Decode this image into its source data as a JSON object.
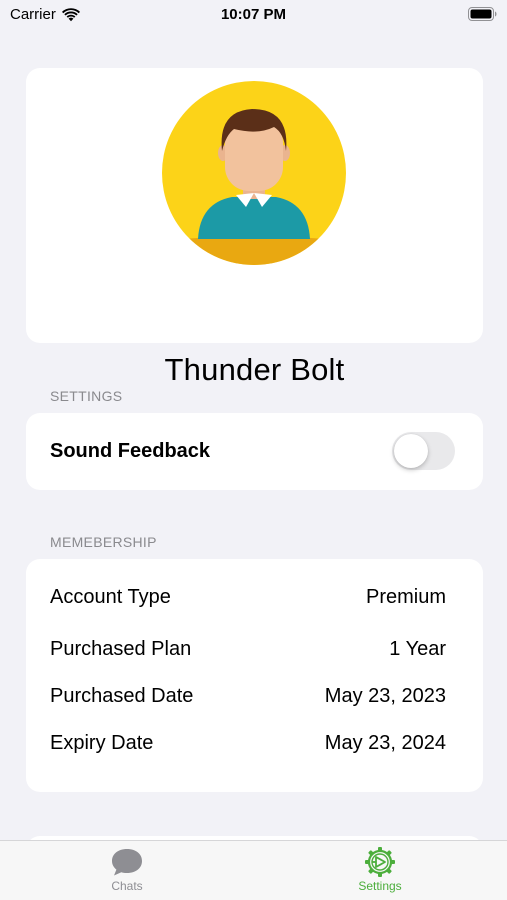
{
  "status_bar": {
    "carrier": "Carrier",
    "time": "10:07 PM"
  },
  "profile": {
    "name": "Thunder Bolt",
    "avatar_icon": "person-avatar-icon",
    "avatar_bg_color": "#fcd318"
  },
  "settings_section": {
    "header": "SETTINGS",
    "sound_feedback_label": "Sound Feedback",
    "sound_feedback_enabled": false
  },
  "membership_section": {
    "header": "MEMEBERSHIP",
    "rows": [
      {
        "label": "Account Type",
        "value": "Premium"
      },
      {
        "label": "Purchased Plan",
        "value": "1 Year"
      },
      {
        "label": "Purchased Date",
        "value": "May 23, 2023"
      },
      {
        "label": "Expiry Date",
        "value": "May 23, 2024"
      }
    ]
  },
  "tab_bar": {
    "tabs": [
      {
        "label": "Chats",
        "icon": "chat-bubble-icon",
        "selected": false
      },
      {
        "label": "Settings",
        "icon": "settings-gear-icon",
        "selected": true
      }
    ],
    "accent_color": "#4cae3c",
    "inactive_color": "#8e8e93"
  }
}
